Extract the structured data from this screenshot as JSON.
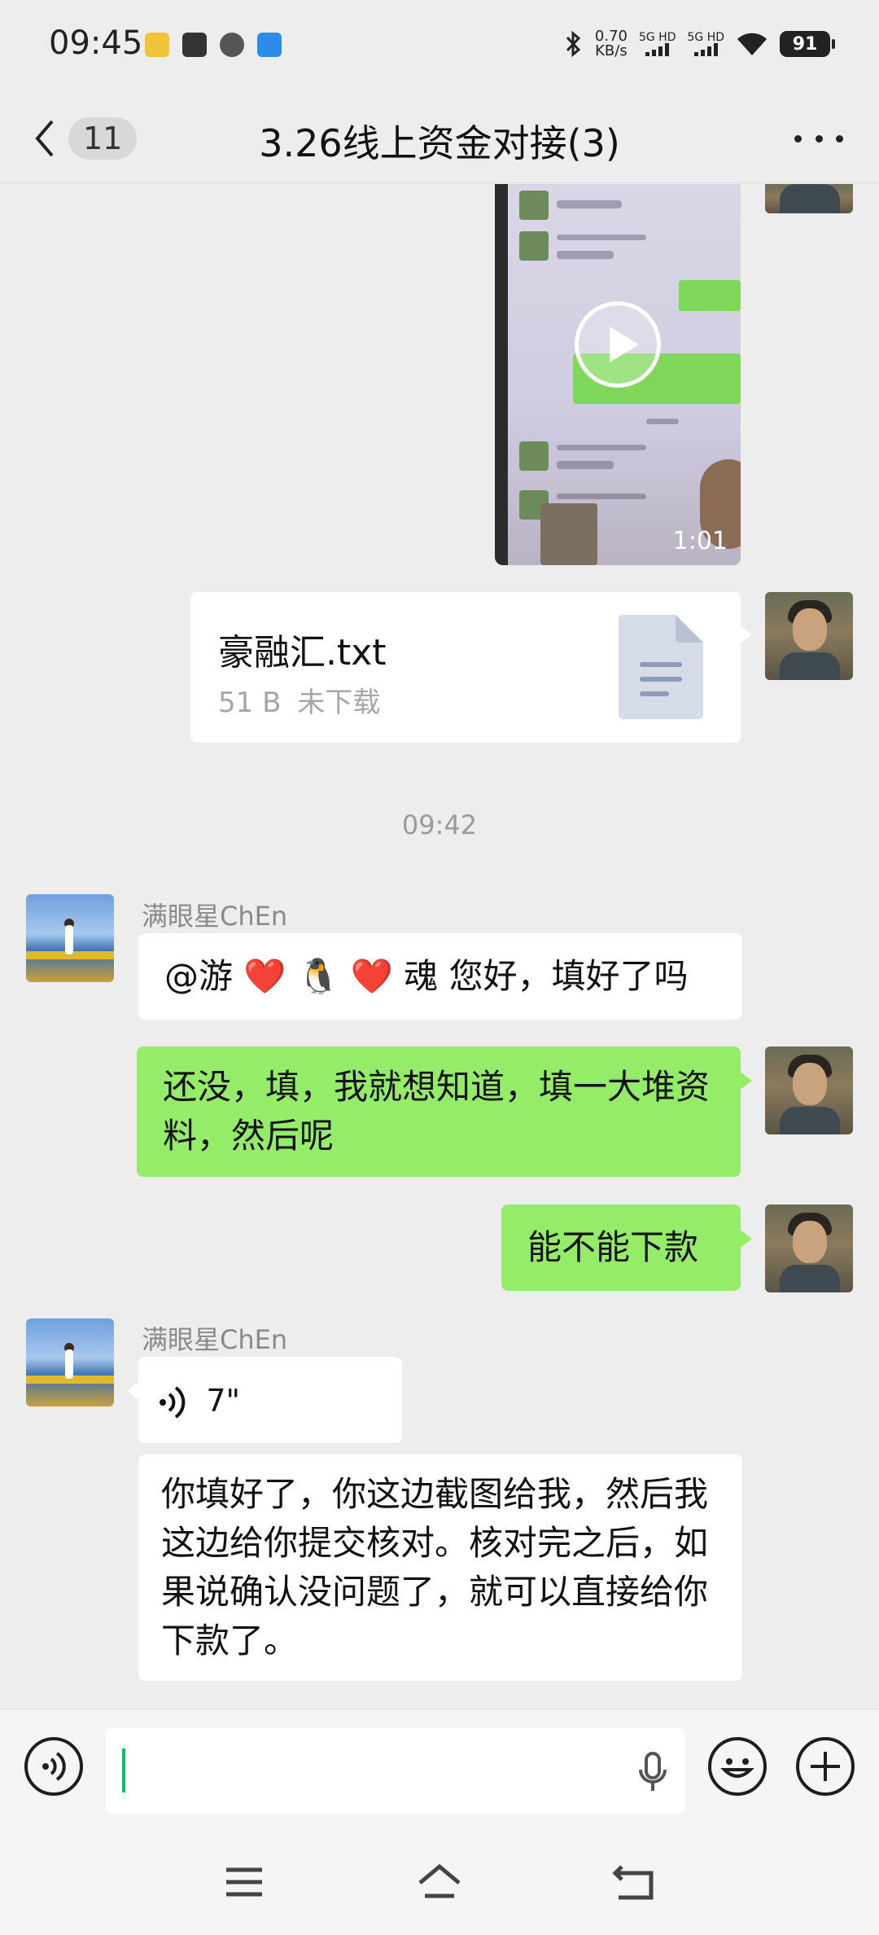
{
  "status_bar": {
    "time": "09:45",
    "net_speed_value": "0.70",
    "net_speed_unit": "KB/s",
    "sim1_label": "5G HD",
    "sim2_label": "5G HD",
    "battery": "91",
    "icons": [
      "notification-app-icon",
      "bag-app-icon",
      "browser-app-icon",
      "send-app-icon",
      "bluetooth-icon",
      "wifi-icon"
    ]
  },
  "header": {
    "unread_count": "11",
    "title": "3.26线上资金对接(3)"
  },
  "messages": {
    "video": {
      "duration": "1:01"
    },
    "file": {
      "name": "豪融汇.txt",
      "size": "51 B",
      "status": "未下载"
    },
    "time_separator": "09:42",
    "sender_name": "满眼星ChEn",
    "msg1": "@游 ❤️ 🐧 ❤️ 魂  您好，填好了吗",
    "msg2": "还没，填，我就想知道，填一大堆资料，然后呢",
    "msg3": "能不能下款",
    "sender_name_2": "满眼星ChEn",
    "voice_duration": "7\"",
    "msg4": "你填好了，你这边截图给我，然后我这边给你提交核对。核对完之后，如果说确认没问题了，就可以直接给你下款了。"
  },
  "colors": {
    "background": "#ededed",
    "self_bubble": "#95ec69",
    "other_bubble": "#ffffff",
    "caret": "#07c160"
  }
}
